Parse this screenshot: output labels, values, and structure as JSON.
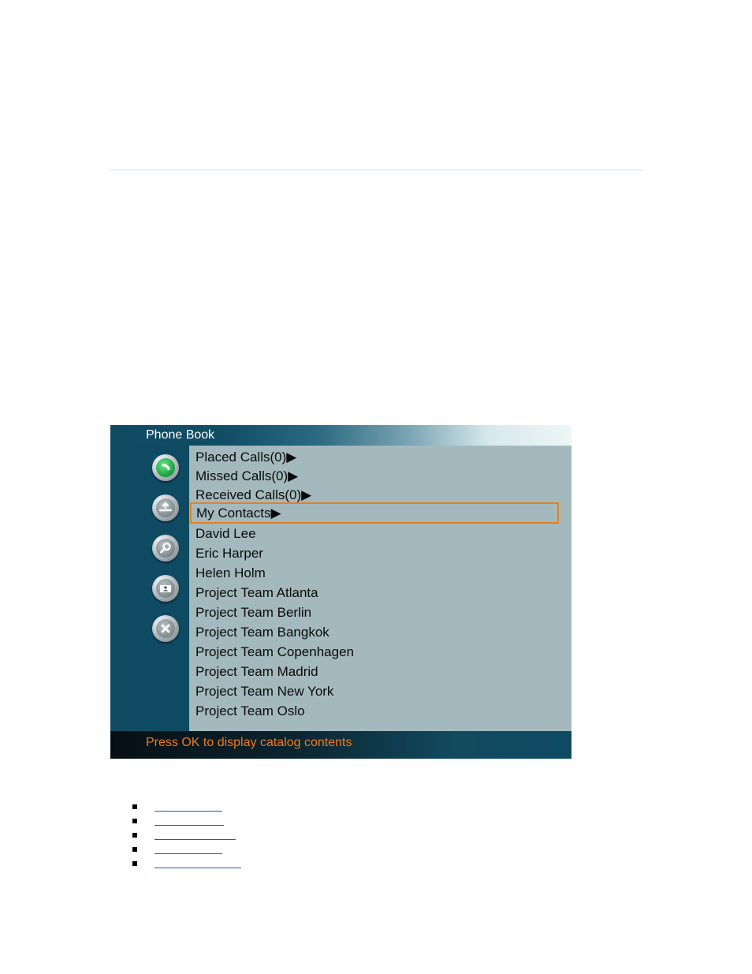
{
  "phonebook": {
    "title": "Phone Book",
    "items": [
      "Placed Calls(0)▶",
      "Missed Calls(0)▶",
      "Received Calls(0)▶",
      "My Contacts▶",
      "David Lee",
      "Eric Harper",
      "Helen Holm",
      "Project Team Atlanta",
      "Project Team Berlin",
      "Project Team Bangkok",
      "Project Team Copenhagen",
      "Project Team Madrid",
      "Project Team New York",
      "Project Team Oslo"
    ],
    "selected_index": 3,
    "status": "Press OK to display catalog contents",
    "side_buttons": [
      "call-icon",
      "upload-icon",
      "search-icon",
      "contact-card-icon",
      "close-icon"
    ]
  },
  "colors": {
    "panel": "#0e4a62",
    "list_bg": "#a3b9be",
    "highlight": "#e8811a",
    "status_text": "#f07a1e",
    "link": "#1d55cc"
  },
  "links": [
    "",
    "",
    "",
    "",
    ""
  ]
}
